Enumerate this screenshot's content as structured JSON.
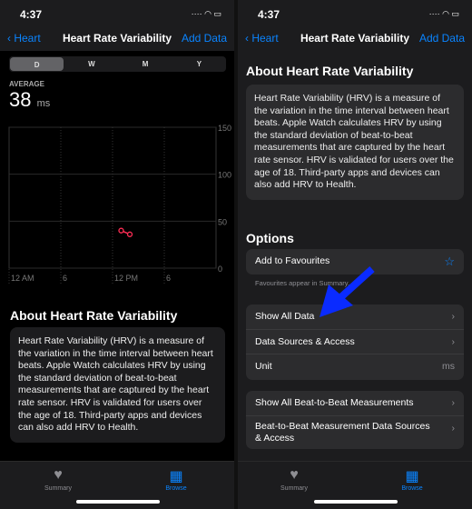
{
  "status": {
    "time": "4:37"
  },
  "left": {
    "nav": {
      "back": "Heart",
      "title": "Heart Rate Variability",
      "add": "Add Data"
    },
    "segments": [
      "D",
      "W",
      "M",
      "Y"
    ],
    "selected_segment": "D",
    "average": {
      "label": "AVERAGE",
      "value": "38",
      "unit": "ms"
    },
    "chart_data": {
      "type": "line",
      "x_ticks": [
        "12 AM",
        "6",
        "12 PM",
        "6"
      ],
      "y_ticks": [
        "150",
        "100",
        "50",
        "0"
      ],
      "ylim": [
        0,
        150
      ],
      "xlim_hours": [
        0,
        24
      ],
      "grid": true,
      "color": "#ff2d55",
      "points": [
        {
          "time": "1 PM",
          "value": 40
        },
        {
          "time": "2 PM",
          "value": 36
        }
      ]
    },
    "about": {
      "heading": "About Heart Rate Variability",
      "text": "Heart Rate Variability (HRV) is a measure of the variation in the time interval between heart beats. Apple Watch calculates HRV by using the standard deviation of beat-to-beat measurements that are captured by the heart rate sensor. HRV is validated for users over the age of 18. Third-party apps and devices can also add HRV to Health."
    }
  },
  "right": {
    "nav": {
      "back": "Heart",
      "title": "Heart Rate Variability",
      "add": "Add Data"
    },
    "about": {
      "heading": "About Heart Rate Variability",
      "text": "Heart Rate Variability (HRV) is a measure of the variation in the time interval between heart beats. Apple Watch calculates HRV by using the standard deviation of beat-to-beat measurements that are captured by the heart rate sensor. HRV is validated for users over the age of 18. Third-party apps and devices can also add HRV to Health."
    },
    "options": {
      "heading": "Options",
      "favourites": "Add to Favourites",
      "footnote": "Favourites appear in Summary.",
      "show_all": "Show All Data",
      "sources": "Data Sources & Access",
      "unit_label": "Unit",
      "unit_value": "ms",
      "beat_all": "Show All Beat-to-Beat Measurements",
      "beat_sources": "Beat-to-Beat Measurement Data Sources & Access"
    },
    "annotation_arrow_color": "#0a2bff"
  },
  "tabbar": {
    "summary": "Summary",
    "browse": "Browse"
  }
}
